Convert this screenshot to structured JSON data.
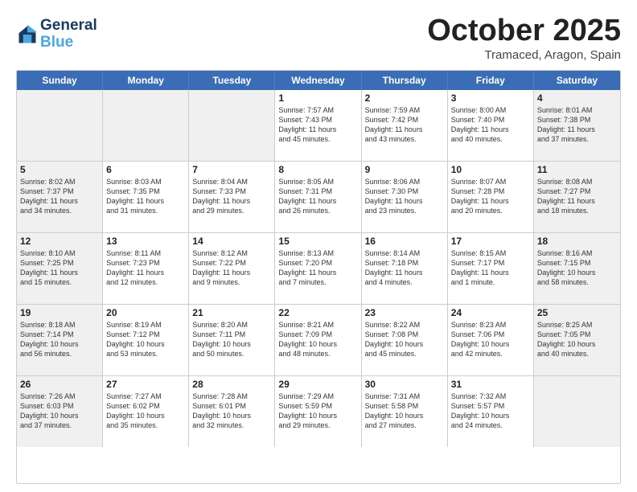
{
  "header": {
    "logo_line1": "General",
    "logo_line2": "Blue",
    "month": "October 2025",
    "location": "Tramaced, Aragon, Spain"
  },
  "weekdays": [
    "Sunday",
    "Monday",
    "Tuesday",
    "Wednesday",
    "Thursday",
    "Friday",
    "Saturday"
  ],
  "weeks": [
    [
      {
        "day": "",
        "info": "",
        "shaded": true
      },
      {
        "day": "",
        "info": "",
        "shaded": true
      },
      {
        "day": "",
        "info": "",
        "shaded": true
      },
      {
        "day": "1",
        "info": "Sunrise: 7:57 AM\nSunset: 7:43 PM\nDaylight: 11 hours\nand 45 minutes.",
        "shaded": false
      },
      {
        "day": "2",
        "info": "Sunrise: 7:59 AM\nSunset: 7:42 PM\nDaylight: 11 hours\nand 43 minutes.",
        "shaded": false
      },
      {
        "day": "3",
        "info": "Sunrise: 8:00 AM\nSunset: 7:40 PM\nDaylight: 11 hours\nand 40 minutes.",
        "shaded": false
      },
      {
        "day": "4",
        "info": "Sunrise: 8:01 AM\nSunset: 7:38 PM\nDaylight: 11 hours\nand 37 minutes.",
        "shaded": true
      }
    ],
    [
      {
        "day": "5",
        "info": "Sunrise: 8:02 AM\nSunset: 7:37 PM\nDaylight: 11 hours\nand 34 minutes.",
        "shaded": true
      },
      {
        "day": "6",
        "info": "Sunrise: 8:03 AM\nSunset: 7:35 PM\nDaylight: 11 hours\nand 31 minutes.",
        "shaded": false
      },
      {
        "day": "7",
        "info": "Sunrise: 8:04 AM\nSunset: 7:33 PM\nDaylight: 11 hours\nand 29 minutes.",
        "shaded": false
      },
      {
        "day": "8",
        "info": "Sunrise: 8:05 AM\nSunset: 7:31 PM\nDaylight: 11 hours\nand 26 minutes.",
        "shaded": false
      },
      {
        "day": "9",
        "info": "Sunrise: 8:06 AM\nSunset: 7:30 PM\nDaylight: 11 hours\nand 23 minutes.",
        "shaded": false
      },
      {
        "day": "10",
        "info": "Sunrise: 8:07 AM\nSunset: 7:28 PM\nDaylight: 11 hours\nand 20 minutes.",
        "shaded": false
      },
      {
        "day": "11",
        "info": "Sunrise: 8:08 AM\nSunset: 7:27 PM\nDaylight: 11 hours\nand 18 minutes.",
        "shaded": true
      }
    ],
    [
      {
        "day": "12",
        "info": "Sunrise: 8:10 AM\nSunset: 7:25 PM\nDaylight: 11 hours\nand 15 minutes.",
        "shaded": true
      },
      {
        "day": "13",
        "info": "Sunrise: 8:11 AM\nSunset: 7:23 PM\nDaylight: 11 hours\nand 12 minutes.",
        "shaded": false
      },
      {
        "day": "14",
        "info": "Sunrise: 8:12 AM\nSunset: 7:22 PM\nDaylight: 11 hours\nand 9 minutes.",
        "shaded": false
      },
      {
        "day": "15",
        "info": "Sunrise: 8:13 AM\nSunset: 7:20 PM\nDaylight: 11 hours\nand 7 minutes.",
        "shaded": false
      },
      {
        "day": "16",
        "info": "Sunrise: 8:14 AM\nSunset: 7:18 PM\nDaylight: 11 hours\nand 4 minutes.",
        "shaded": false
      },
      {
        "day": "17",
        "info": "Sunrise: 8:15 AM\nSunset: 7:17 PM\nDaylight: 11 hours\nand 1 minute.",
        "shaded": false
      },
      {
        "day": "18",
        "info": "Sunrise: 8:16 AM\nSunset: 7:15 PM\nDaylight: 10 hours\nand 58 minutes.",
        "shaded": true
      }
    ],
    [
      {
        "day": "19",
        "info": "Sunrise: 8:18 AM\nSunset: 7:14 PM\nDaylight: 10 hours\nand 56 minutes.",
        "shaded": true
      },
      {
        "day": "20",
        "info": "Sunrise: 8:19 AM\nSunset: 7:12 PM\nDaylight: 10 hours\nand 53 minutes.",
        "shaded": false
      },
      {
        "day": "21",
        "info": "Sunrise: 8:20 AM\nSunset: 7:11 PM\nDaylight: 10 hours\nand 50 minutes.",
        "shaded": false
      },
      {
        "day": "22",
        "info": "Sunrise: 8:21 AM\nSunset: 7:09 PM\nDaylight: 10 hours\nand 48 minutes.",
        "shaded": false
      },
      {
        "day": "23",
        "info": "Sunrise: 8:22 AM\nSunset: 7:08 PM\nDaylight: 10 hours\nand 45 minutes.",
        "shaded": false
      },
      {
        "day": "24",
        "info": "Sunrise: 8:23 AM\nSunset: 7:06 PM\nDaylight: 10 hours\nand 42 minutes.",
        "shaded": false
      },
      {
        "day": "25",
        "info": "Sunrise: 8:25 AM\nSunset: 7:05 PM\nDaylight: 10 hours\nand 40 minutes.",
        "shaded": true
      }
    ],
    [
      {
        "day": "26",
        "info": "Sunrise: 7:26 AM\nSunset: 6:03 PM\nDaylight: 10 hours\nand 37 minutes.",
        "shaded": true
      },
      {
        "day": "27",
        "info": "Sunrise: 7:27 AM\nSunset: 6:02 PM\nDaylight: 10 hours\nand 35 minutes.",
        "shaded": false
      },
      {
        "day": "28",
        "info": "Sunrise: 7:28 AM\nSunset: 6:01 PM\nDaylight: 10 hours\nand 32 minutes.",
        "shaded": false
      },
      {
        "day": "29",
        "info": "Sunrise: 7:29 AM\nSunset: 5:59 PM\nDaylight: 10 hours\nand 29 minutes.",
        "shaded": false
      },
      {
        "day": "30",
        "info": "Sunrise: 7:31 AM\nSunset: 5:58 PM\nDaylight: 10 hours\nand 27 minutes.",
        "shaded": false
      },
      {
        "day": "31",
        "info": "Sunrise: 7:32 AM\nSunset: 5:57 PM\nDaylight: 10 hours\nand 24 minutes.",
        "shaded": false
      },
      {
        "day": "",
        "info": "",
        "shaded": true
      }
    ]
  ]
}
